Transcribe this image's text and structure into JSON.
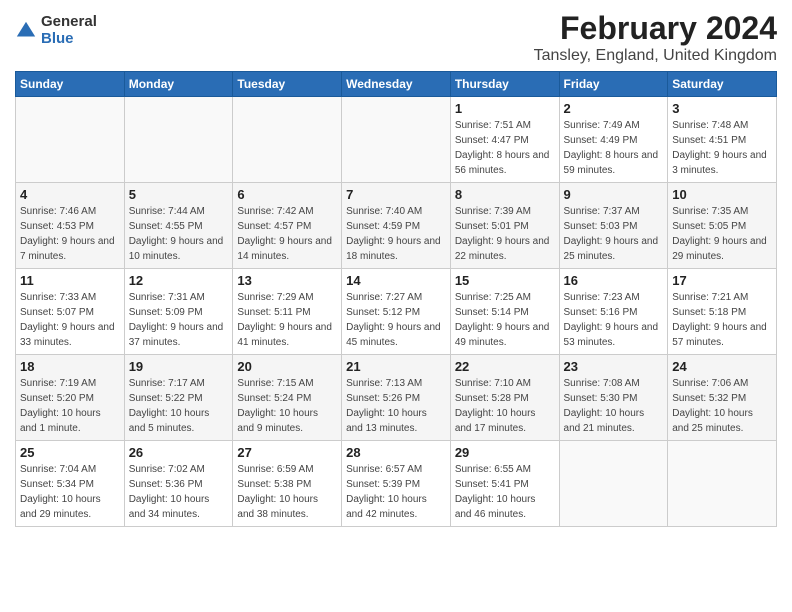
{
  "logo": {
    "general": "General",
    "blue": "Blue"
  },
  "title": "February 2024",
  "subtitle": "Tansley, England, United Kingdom",
  "days_of_week": [
    "Sunday",
    "Monday",
    "Tuesday",
    "Wednesday",
    "Thursday",
    "Friday",
    "Saturday"
  ],
  "weeks": [
    [
      {
        "day": "",
        "sunrise": "",
        "sunset": "",
        "daylight": ""
      },
      {
        "day": "",
        "sunrise": "",
        "sunset": "",
        "daylight": ""
      },
      {
        "day": "",
        "sunrise": "",
        "sunset": "",
        "daylight": ""
      },
      {
        "day": "",
        "sunrise": "",
        "sunset": "",
        "daylight": ""
      },
      {
        "day": "1",
        "sunrise": "Sunrise: 7:51 AM",
        "sunset": "Sunset: 4:47 PM",
        "daylight": "Daylight: 8 hours and 56 minutes."
      },
      {
        "day": "2",
        "sunrise": "Sunrise: 7:49 AM",
        "sunset": "Sunset: 4:49 PM",
        "daylight": "Daylight: 8 hours and 59 minutes."
      },
      {
        "day": "3",
        "sunrise": "Sunrise: 7:48 AM",
        "sunset": "Sunset: 4:51 PM",
        "daylight": "Daylight: 9 hours and 3 minutes."
      }
    ],
    [
      {
        "day": "4",
        "sunrise": "Sunrise: 7:46 AM",
        "sunset": "Sunset: 4:53 PM",
        "daylight": "Daylight: 9 hours and 7 minutes."
      },
      {
        "day": "5",
        "sunrise": "Sunrise: 7:44 AM",
        "sunset": "Sunset: 4:55 PM",
        "daylight": "Daylight: 9 hours and 10 minutes."
      },
      {
        "day": "6",
        "sunrise": "Sunrise: 7:42 AM",
        "sunset": "Sunset: 4:57 PM",
        "daylight": "Daylight: 9 hours and 14 minutes."
      },
      {
        "day": "7",
        "sunrise": "Sunrise: 7:40 AM",
        "sunset": "Sunset: 4:59 PM",
        "daylight": "Daylight: 9 hours and 18 minutes."
      },
      {
        "day": "8",
        "sunrise": "Sunrise: 7:39 AM",
        "sunset": "Sunset: 5:01 PM",
        "daylight": "Daylight: 9 hours and 22 minutes."
      },
      {
        "day": "9",
        "sunrise": "Sunrise: 7:37 AM",
        "sunset": "Sunset: 5:03 PM",
        "daylight": "Daylight: 9 hours and 25 minutes."
      },
      {
        "day": "10",
        "sunrise": "Sunrise: 7:35 AM",
        "sunset": "Sunset: 5:05 PM",
        "daylight": "Daylight: 9 hours and 29 minutes."
      }
    ],
    [
      {
        "day": "11",
        "sunrise": "Sunrise: 7:33 AM",
        "sunset": "Sunset: 5:07 PM",
        "daylight": "Daylight: 9 hours and 33 minutes."
      },
      {
        "day": "12",
        "sunrise": "Sunrise: 7:31 AM",
        "sunset": "Sunset: 5:09 PM",
        "daylight": "Daylight: 9 hours and 37 minutes."
      },
      {
        "day": "13",
        "sunrise": "Sunrise: 7:29 AM",
        "sunset": "Sunset: 5:11 PM",
        "daylight": "Daylight: 9 hours and 41 minutes."
      },
      {
        "day": "14",
        "sunrise": "Sunrise: 7:27 AM",
        "sunset": "Sunset: 5:12 PM",
        "daylight": "Daylight: 9 hours and 45 minutes."
      },
      {
        "day": "15",
        "sunrise": "Sunrise: 7:25 AM",
        "sunset": "Sunset: 5:14 PM",
        "daylight": "Daylight: 9 hours and 49 minutes."
      },
      {
        "day": "16",
        "sunrise": "Sunrise: 7:23 AM",
        "sunset": "Sunset: 5:16 PM",
        "daylight": "Daylight: 9 hours and 53 minutes."
      },
      {
        "day": "17",
        "sunrise": "Sunrise: 7:21 AM",
        "sunset": "Sunset: 5:18 PM",
        "daylight": "Daylight: 9 hours and 57 minutes."
      }
    ],
    [
      {
        "day": "18",
        "sunrise": "Sunrise: 7:19 AM",
        "sunset": "Sunset: 5:20 PM",
        "daylight": "Daylight: 10 hours and 1 minute."
      },
      {
        "day": "19",
        "sunrise": "Sunrise: 7:17 AM",
        "sunset": "Sunset: 5:22 PM",
        "daylight": "Daylight: 10 hours and 5 minutes."
      },
      {
        "day": "20",
        "sunrise": "Sunrise: 7:15 AM",
        "sunset": "Sunset: 5:24 PM",
        "daylight": "Daylight: 10 hours and 9 minutes."
      },
      {
        "day": "21",
        "sunrise": "Sunrise: 7:13 AM",
        "sunset": "Sunset: 5:26 PM",
        "daylight": "Daylight: 10 hours and 13 minutes."
      },
      {
        "day": "22",
        "sunrise": "Sunrise: 7:10 AM",
        "sunset": "Sunset: 5:28 PM",
        "daylight": "Daylight: 10 hours and 17 minutes."
      },
      {
        "day": "23",
        "sunrise": "Sunrise: 7:08 AM",
        "sunset": "Sunset: 5:30 PM",
        "daylight": "Daylight: 10 hours and 21 minutes."
      },
      {
        "day": "24",
        "sunrise": "Sunrise: 7:06 AM",
        "sunset": "Sunset: 5:32 PM",
        "daylight": "Daylight: 10 hours and 25 minutes."
      }
    ],
    [
      {
        "day": "25",
        "sunrise": "Sunrise: 7:04 AM",
        "sunset": "Sunset: 5:34 PM",
        "daylight": "Daylight: 10 hours and 29 minutes."
      },
      {
        "day": "26",
        "sunrise": "Sunrise: 7:02 AM",
        "sunset": "Sunset: 5:36 PM",
        "daylight": "Daylight: 10 hours and 34 minutes."
      },
      {
        "day": "27",
        "sunrise": "Sunrise: 6:59 AM",
        "sunset": "Sunset: 5:38 PM",
        "daylight": "Daylight: 10 hours and 38 minutes."
      },
      {
        "day": "28",
        "sunrise": "Sunrise: 6:57 AM",
        "sunset": "Sunset: 5:39 PM",
        "daylight": "Daylight: 10 hours and 42 minutes."
      },
      {
        "day": "29",
        "sunrise": "Sunrise: 6:55 AM",
        "sunset": "Sunset: 5:41 PM",
        "daylight": "Daylight: 10 hours and 46 minutes."
      },
      {
        "day": "",
        "sunrise": "",
        "sunset": "",
        "daylight": ""
      },
      {
        "day": "",
        "sunrise": "",
        "sunset": "",
        "daylight": ""
      }
    ]
  ]
}
